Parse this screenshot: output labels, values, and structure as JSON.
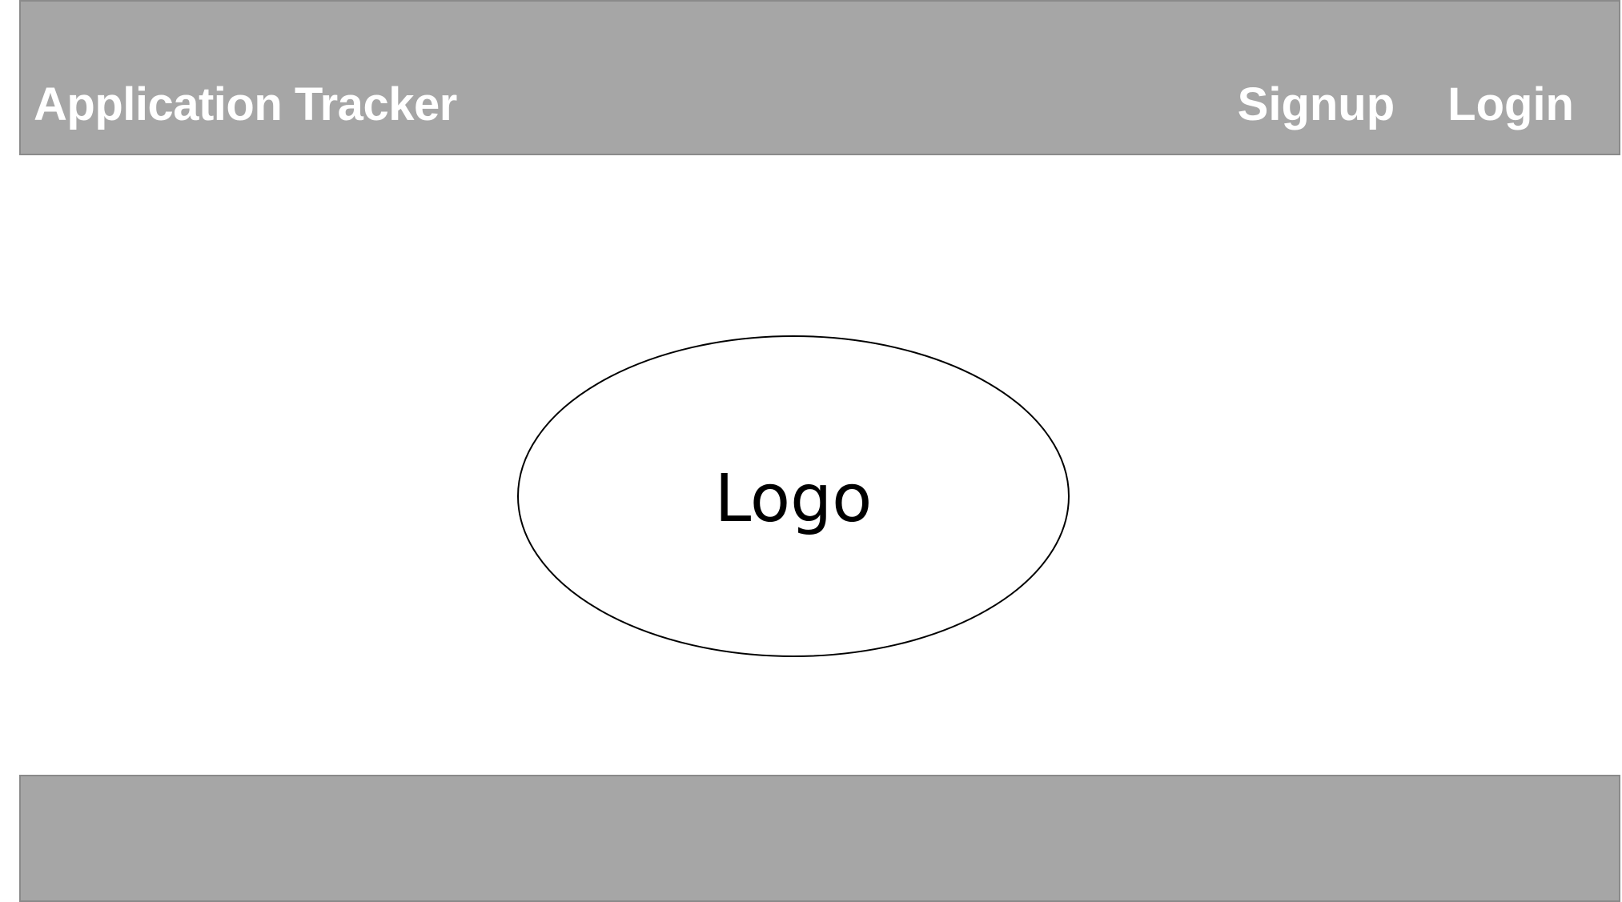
{
  "header": {
    "title": "Application Tracker",
    "nav": {
      "signup_label": "Signup",
      "login_label": "Login"
    }
  },
  "hero": {
    "logo_label": "Logo"
  },
  "colors": {
    "bar_background": "#a6a6a6",
    "bar_border": "#8a8a8a",
    "header_text": "#ffffff",
    "logo_text": "#000000",
    "page_background": "#ffffff"
  }
}
